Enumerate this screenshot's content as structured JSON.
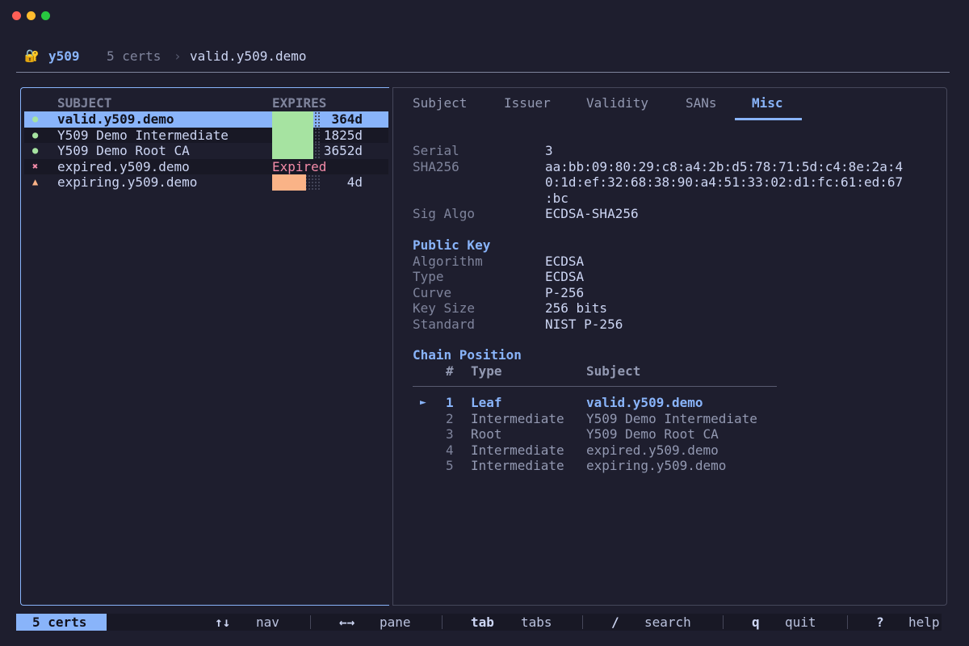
{
  "header": {
    "lock_icon": "🔐",
    "app_name": "y509",
    "cert_count": "5 certs",
    "separator": "›",
    "crumb": "valid.y509.demo"
  },
  "list": {
    "col_subject": "SUBJECT",
    "col_expires": "EXPIRES",
    "rows": [
      {
        "icon": "●",
        "name": "valid.y509.demo",
        "days": "364d",
        "fill": 0.85,
        "color": "#a6e3a1"
      },
      {
        "icon": "●",
        "name": "Y509 Demo Intermediate",
        "days": "1825d",
        "fill": 0.85,
        "color": "#a6e3a1"
      },
      {
        "icon": "●",
        "name": "Y509 Demo Root CA",
        "days": "3652d",
        "fill": 0.85,
        "color": "#a6e3a1"
      },
      {
        "icon": "✖",
        "name": "expired.y509.demo",
        "status": "Expired",
        "color": "#f38ba8"
      },
      {
        "icon": "▲",
        "name": "expiring.y509.demo",
        "days": "4d",
        "fill": 0.7,
        "color": "#fab387"
      }
    ]
  },
  "tabs": [
    "Subject",
    "Issuer",
    "Validity",
    "SANs",
    "Misc"
  ],
  "active_tab": "Misc",
  "misc": {
    "serial_label": "Serial",
    "serial": "3",
    "sha_label": "SHA256",
    "sha_line1": "aa:bb:09:80:29:c8:a4:2b:d5:78:71:5d:c4:8e:2a:4",
    "sha_line2": "0:1d:ef:32:68:38:90:a4:51:33:02:d1:fc:61:ed:67",
    "sha_line3": ":bc",
    "sigalgo_label": "Sig Algo",
    "sigalgo": "ECDSA-SHA256",
    "pubkey_title": "Public Key",
    "algorithm_label": "Algorithm",
    "algorithm": "ECDSA",
    "type_label": "Type",
    "type": "ECDSA",
    "curve_label": "Curve",
    "curve": "P-256",
    "keysize_label": "Key Size",
    "keysize": "256 bits",
    "standard_label": "Standard",
    "standard": "NIST P-256",
    "chain_title": "Chain Position",
    "chain_col_num": "#",
    "chain_col_type": "Type",
    "chain_col_subject": "Subject",
    "chain_marker": "►",
    "chain": [
      {
        "num": "1",
        "type": "Leaf",
        "subject": "valid.y509.demo"
      },
      {
        "num": "2",
        "type": "Intermediate",
        "subject": "Y509 Demo Intermediate"
      },
      {
        "num": "3",
        "type": "Root",
        "subject": "Y509 Demo Root CA"
      },
      {
        "num": "4",
        "type": "Intermediate",
        "subject": "expired.y509.demo"
      },
      {
        "num": "5",
        "type": "Intermediate",
        "subject": "expiring.y509.demo"
      }
    ]
  },
  "statusbar": {
    "badge": "5 certs",
    "nav_key": "↑↓",
    "nav_label": "nav",
    "pane_key": "←→",
    "pane_label": "pane",
    "tab_key": "tab",
    "tab_label": "tabs",
    "search_key": "/",
    "search_label": "search",
    "quit_key": "q",
    "quit_label": "quit",
    "help_key": "?",
    "help_label": "help"
  }
}
